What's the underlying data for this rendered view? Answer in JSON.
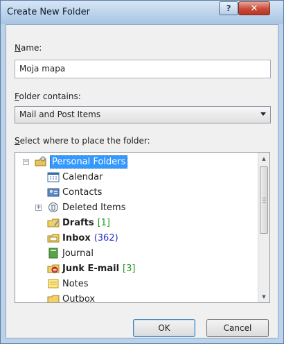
{
  "window": {
    "title": "Create New Folder",
    "help_label": "?",
    "close_label": "✕"
  },
  "name": {
    "label_key": "N",
    "label_rest": "ame:",
    "value": "Moja mapa"
  },
  "contains": {
    "label_key": "F",
    "label_rest": "older contains:",
    "selected": "Mail and Post Items"
  },
  "place": {
    "label_key": "S",
    "label_rest": "elect where to place the folder:"
  },
  "tree": {
    "root": {
      "label": "Personal Folders",
      "expander": "⊟",
      "selected": true
    },
    "items": [
      {
        "label": "Calendar",
        "count": "",
        "bold": false
      },
      {
        "label": "Contacts",
        "count": "",
        "bold": false
      },
      {
        "label": "Deleted Items",
        "count": "",
        "bold": false,
        "expander": "+"
      },
      {
        "label": "Drafts",
        "count": "[1]",
        "bold": true
      },
      {
        "label": "Inbox",
        "count": "(362)",
        "bold": true
      },
      {
        "label": "Journal",
        "count": "",
        "bold": false
      },
      {
        "label": "Junk E-mail",
        "count": "[3]",
        "bold": true
      },
      {
        "label": "Notes",
        "count": "",
        "bold": false
      },
      {
        "label": "Outbox",
        "count": "",
        "bold": false
      }
    ]
  },
  "buttons": {
    "ok": "OK",
    "cancel": "Cancel"
  },
  "colors": {
    "selection": "#3399ff",
    "count_green": "#1a9a1a",
    "count_blue": "#2431c8"
  }
}
